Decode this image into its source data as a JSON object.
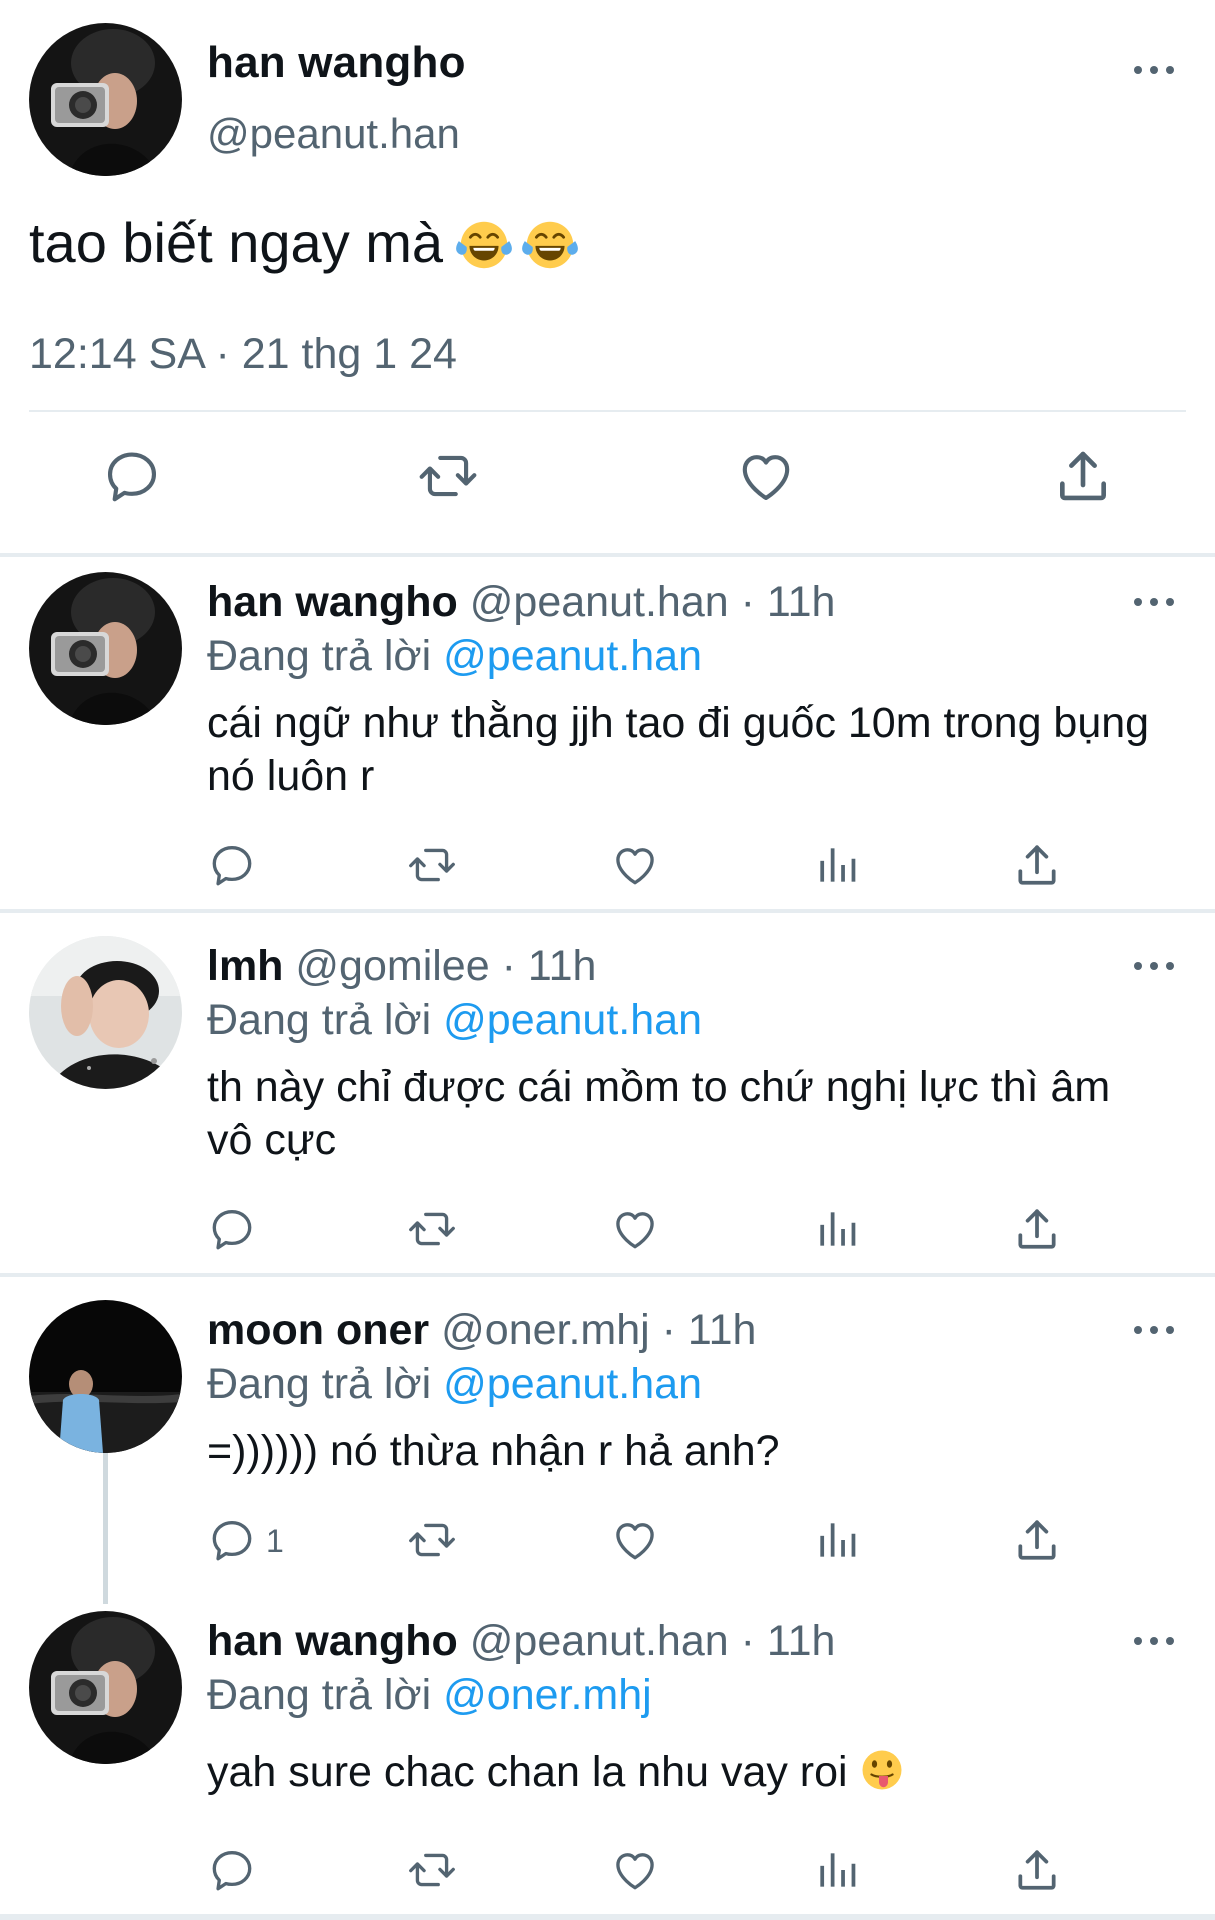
{
  "main_tweet": {
    "author_name": "han wangho",
    "author_handle": "@peanut.han",
    "text": "tao biết ngay mà",
    "emojis": [
      "face-with-tears-of-joy",
      "face-with-tears-of-joy"
    ],
    "timestamp": "12:14 SA · 21 thg 1 24",
    "actions": [
      "reply-icon",
      "retweet-icon",
      "like-icon",
      "share-icon"
    ]
  },
  "replies": [
    {
      "name": "han wangho",
      "meta": "@peanut.han · 11h",
      "replying_prefix": "Đang trả lời ",
      "replying_to": "@peanut.han",
      "text": "cái ngữ như thằng jjh tao đi guốc 10m trong bụng nó luôn r",
      "reply_count": ""
    },
    {
      "name": "lmh",
      "meta": "@gomilee · 11h",
      "replying_prefix": "Đang trả lời ",
      "replying_to": "@peanut.han",
      "text": "th này chỉ được cái mồm to chứ nghị lực thì âm vô cực",
      "reply_count": ""
    },
    {
      "name": "moon oner",
      "meta": "@oner.mhj · 11h",
      "replying_prefix": "Đang trả lời ",
      "replying_to": "@peanut.han",
      "text": "=)))))) nó thừa nhận r hả anh?",
      "reply_count": "1"
    },
    {
      "name": "han wangho",
      "meta": "@peanut.han · 11h",
      "replying_prefix": "Đang trả lời ",
      "replying_to": "@oner.mhj",
      "text": "yah sure chac chan la nhu vay roi",
      "emoji": "face-with-tongue",
      "reply_count": ""
    }
  ],
  "colors": {
    "text": "#0f1419",
    "secondary": "#536471",
    "link": "#1d9bf0",
    "divider": "#e6ecf0"
  }
}
